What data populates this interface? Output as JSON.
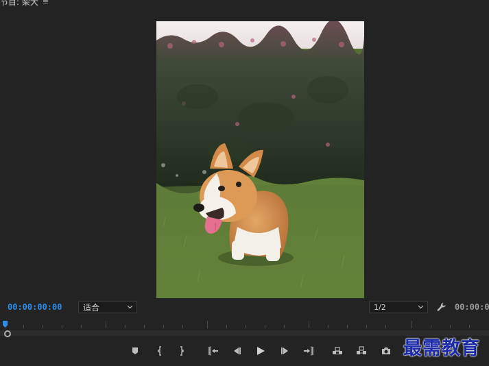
{
  "panel": {
    "title": "节目: 柴犬",
    "menu_icon": "hamburger-menu-icon"
  },
  "viewer": {
    "content": "corgi-dog-on-grass-photo"
  },
  "timecode": {
    "current": "00:00:00:00",
    "duration": "00:00:0"
  },
  "zoom_select": {
    "value": "适合"
  },
  "resolution_select": {
    "value": "1/2"
  },
  "transport": [
    {
      "name": "add-marker-button",
      "icon": "marker-icon"
    },
    {
      "name": "mark-in-button",
      "icon": "mark-in-icon"
    },
    {
      "name": "mark-out-button",
      "icon": "mark-out-icon"
    },
    {
      "name": "go-to-in-button",
      "icon": "go-to-in-icon"
    },
    {
      "name": "step-back-button",
      "icon": "step-back-icon"
    },
    {
      "name": "play-button",
      "icon": "play-icon"
    },
    {
      "name": "step-forward-button",
      "icon": "step-forward-icon"
    },
    {
      "name": "go-to-out-button",
      "icon": "go-to-out-icon"
    },
    {
      "name": "lift-button",
      "icon": "lift-icon"
    },
    {
      "name": "extract-button",
      "icon": "extract-icon"
    },
    {
      "name": "export-frame-button",
      "icon": "camera-icon"
    },
    {
      "name": "compare-view-button",
      "icon": "compare-icon"
    }
  ],
  "watermark": {
    "text": "最需教育"
  },
  "colors": {
    "background": "#232323",
    "accent_timecode": "#2d8ceb",
    "watermark": "#1a2aa8"
  }
}
